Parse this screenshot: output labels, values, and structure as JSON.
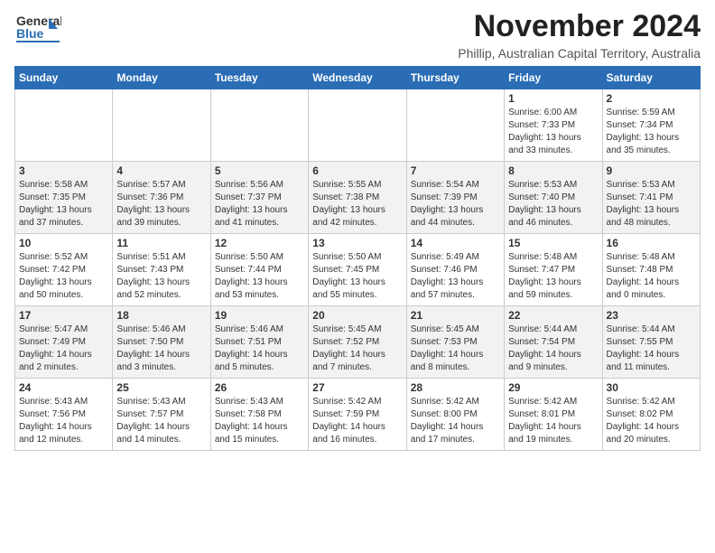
{
  "header": {
    "logo_general": "General",
    "logo_blue": "Blue",
    "month": "November 2024",
    "location": "Phillip, Australian Capital Territory, Australia"
  },
  "days_of_week": [
    "Sunday",
    "Monday",
    "Tuesday",
    "Wednesday",
    "Thursday",
    "Friday",
    "Saturday"
  ],
  "weeks": [
    [
      {
        "day": "",
        "info": ""
      },
      {
        "day": "",
        "info": ""
      },
      {
        "day": "",
        "info": ""
      },
      {
        "day": "",
        "info": ""
      },
      {
        "day": "",
        "info": ""
      },
      {
        "day": "1",
        "info": "Sunrise: 6:00 AM\nSunset: 7:33 PM\nDaylight: 13 hours\nand 33 minutes."
      },
      {
        "day": "2",
        "info": "Sunrise: 5:59 AM\nSunset: 7:34 PM\nDaylight: 13 hours\nand 35 minutes."
      }
    ],
    [
      {
        "day": "3",
        "info": "Sunrise: 5:58 AM\nSunset: 7:35 PM\nDaylight: 13 hours\nand 37 minutes."
      },
      {
        "day": "4",
        "info": "Sunrise: 5:57 AM\nSunset: 7:36 PM\nDaylight: 13 hours\nand 39 minutes."
      },
      {
        "day": "5",
        "info": "Sunrise: 5:56 AM\nSunset: 7:37 PM\nDaylight: 13 hours\nand 41 minutes."
      },
      {
        "day": "6",
        "info": "Sunrise: 5:55 AM\nSunset: 7:38 PM\nDaylight: 13 hours\nand 42 minutes."
      },
      {
        "day": "7",
        "info": "Sunrise: 5:54 AM\nSunset: 7:39 PM\nDaylight: 13 hours\nand 44 minutes."
      },
      {
        "day": "8",
        "info": "Sunrise: 5:53 AM\nSunset: 7:40 PM\nDaylight: 13 hours\nand 46 minutes."
      },
      {
        "day": "9",
        "info": "Sunrise: 5:53 AM\nSunset: 7:41 PM\nDaylight: 13 hours\nand 48 minutes."
      }
    ],
    [
      {
        "day": "10",
        "info": "Sunrise: 5:52 AM\nSunset: 7:42 PM\nDaylight: 13 hours\nand 50 minutes."
      },
      {
        "day": "11",
        "info": "Sunrise: 5:51 AM\nSunset: 7:43 PM\nDaylight: 13 hours\nand 52 minutes."
      },
      {
        "day": "12",
        "info": "Sunrise: 5:50 AM\nSunset: 7:44 PM\nDaylight: 13 hours\nand 53 minutes."
      },
      {
        "day": "13",
        "info": "Sunrise: 5:50 AM\nSunset: 7:45 PM\nDaylight: 13 hours\nand 55 minutes."
      },
      {
        "day": "14",
        "info": "Sunrise: 5:49 AM\nSunset: 7:46 PM\nDaylight: 13 hours\nand 57 minutes."
      },
      {
        "day": "15",
        "info": "Sunrise: 5:48 AM\nSunset: 7:47 PM\nDaylight: 13 hours\nand 59 minutes."
      },
      {
        "day": "16",
        "info": "Sunrise: 5:48 AM\nSunset: 7:48 PM\nDaylight: 14 hours\nand 0 minutes."
      }
    ],
    [
      {
        "day": "17",
        "info": "Sunrise: 5:47 AM\nSunset: 7:49 PM\nDaylight: 14 hours\nand 2 minutes."
      },
      {
        "day": "18",
        "info": "Sunrise: 5:46 AM\nSunset: 7:50 PM\nDaylight: 14 hours\nand 3 minutes."
      },
      {
        "day": "19",
        "info": "Sunrise: 5:46 AM\nSunset: 7:51 PM\nDaylight: 14 hours\nand 5 minutes."
      },
      {
        "day": "20",
        "info": "Sunrise: 5:45 AM\nSunset: 7:52 PM\nDaylight: 14 hours\nand 7 minutes."
      },
      {
        "day": "21",
        "info": "Sunrise: 5:45 AM\nSunset: 7:53 PM\nDaylight: 14 hours\nand 8 minutes."
      },
      {
        "day": "22",
        "info": "Sunrise: 5:44 AM\nSunset: 7:54 PM\nDaylight: 14 hours\nand 9 minutes."
      },
      {
        "day": "23",
        "info": "Sunrise: 5:44 AM\nSunset: 7:55 PM\nDaylight: 14 hours\nand 11 minutes."
      }
    ],
    [
      {
        "day": "24",
        "info": "Sunrise: 5:43 AM\nSunset: 7:56 PM\nDaylight: 14 hours\nand 12 minutes."
      },
      {
        "day": "25",
        "info": "Sunrise: 5:43 AM\nSunset: 7:57 PM\nDaylight: 14 hours\nand 14 minutes."
      },
      {
        "day": "26",
        "info": "Sunrise: 5:43 AM\nSunset: 7:58 PM\nDaylight: 14 hours\nand 15 minutes."
      },
      {
        "day": "27",
        "info": "Sunrise: 5:42 AM\nSunset: 7:59 PM\nDaylight: 14 hours\nand 16 minutes."
      },
      {
        "day": "28",
        "info": "Sunrise: 5:42 AM\nSunset: 8:00 PM\nDaylight: 14 hours\nand 17 minutes."
      },
      {
        "day": "29",
        "info": "Sunrise: 5:42 AM\nSunset: 8:01 PM\nDaylight: 14 hours\nand 19 minutes."
      },
      {
        "day": "30",
        "info": "Sunrise: 5:42 AM\nSunset: 8:02 PM\nDaylight: 14 hours\nand 20 minutes."
      }
    ]
  ]
}
